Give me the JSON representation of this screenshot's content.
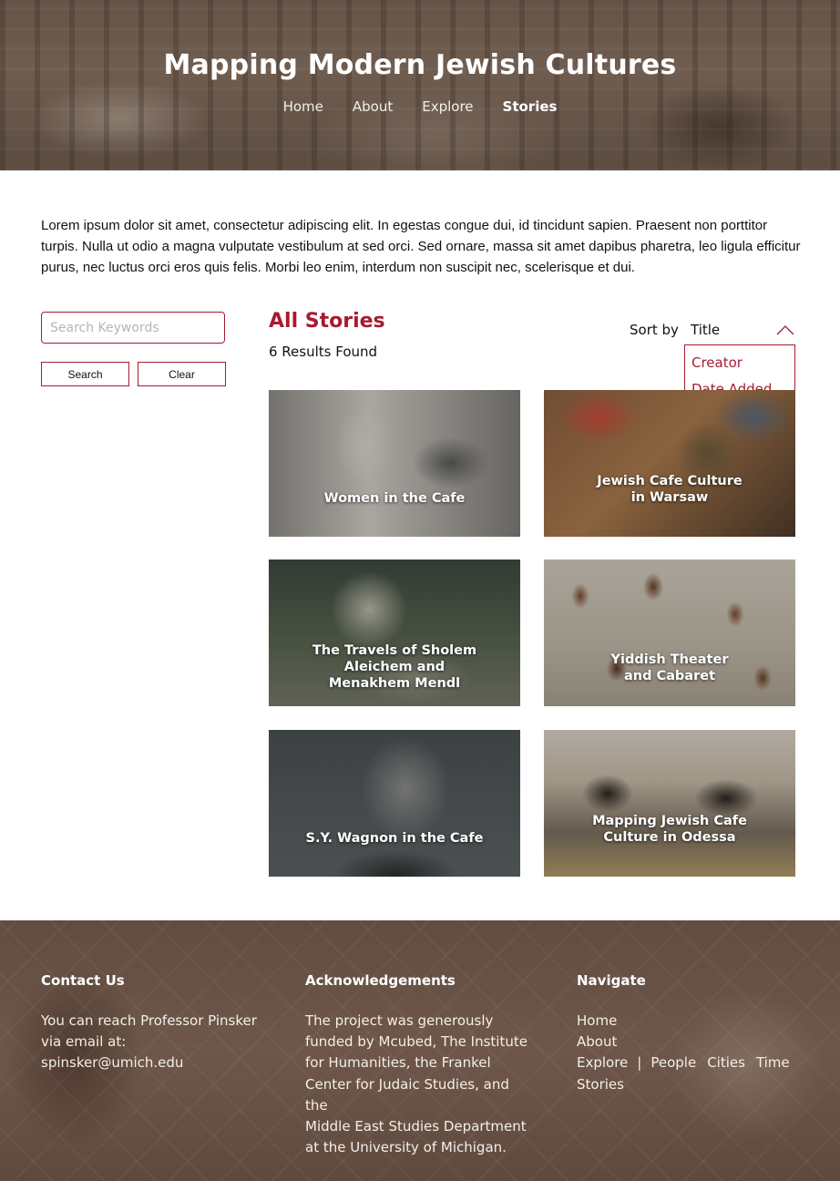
{
  "header": {
    "title": "Mapping Modern Jewish Cultures",
    "nav": [
      {
        "label": "Home"
      },
      {
        "label": "About"
      },
      {
        "label": "Explore"
      },
      {
        "label": "Stories",
        "active": true
      }
    ]
  },
  "intro": {
    "text": "Lorem ipsum dolor sit amet, consectetur adipiscing elit. In egestas congue dui, id tincidunt sapien. Praesent non porttitor turpis. Nulla ut odio a magna vulputate vestibulum at sed orci. Sed ornare, massa sit amet dapibus pharetra, leo ligula efficitur purus, nec luctus orci eros quis felis. Morbi leo enim, interdum non suscipit nec, scelerisque et dui."
  },
  "sidebar": {
    "search_placeholder": "Search Keywords",
    "search_value": "",
    "search_button": "Search",
    "clear_button": "Clear"
  },
  "results": {
    "title": "All Stories",
    "count_text": "6 Results Found",
    "sort_label": "Sort by",
    "sort_selected": "Title",
    "sort_options": [
      "Creator",
      "Date Added"
    ],
    "sort_open": true
  },
  "stories": [
    {
      "title_lines": [
        "Women in the Cafe"
      ]
    },
    {
      "title_lines": [
        "Jewish Cafe Culture",
        "in Warsaw"
      ]
    },
    {
      "title_lines": [
        "The Travels of Sholem",
        "Aleichem and",
        "Menakhem Mendl"
      ]
    },
    {
      "title_lines": [
        "Yiddish Theater",
        "and Cabaret"
      ]
    },
    {
      "title_lines": [
        "S.Y. Wagnon in the Cafe"
      ]
    },
    {
      "title_lines": [
        "Mapping Jewish Cafe",
        "Culture in Odessa"
      ]
    }
  ],
  "footer": {
    "contact": {
      "heading": "Contact Us",
      "lines": [
        "You can reach Professor Pinsker",
        "via email at: spinsker@umich.edu"
      ]
    },
    "acknowledgements": {
      "heading": "Acknowledgements",
      "lines": [
        "The project was generously",
        "funded by Mcubed, The Institute",
        "for Humanities, the Frankel",
        "Center for Judaic Studies, and the",
        "Middle East Studies Department",
        "at the University of Michigan."
      ]
    },
    "navigate": {
      "heading": "Navigate",
      "home": "Home",
      "about": "About",
      "explore": "Explore",
      "separator": "|",
      "explore_sub": [
        "People",
        "Cities",
        "Time"
      ],
      "stories": "Stories"
    }
  },
  "colors": {
    "accent": "#a51c30",
    "header_tint": "#7b6a5d",
    "footer_tint": "#80695b"
  }
}
